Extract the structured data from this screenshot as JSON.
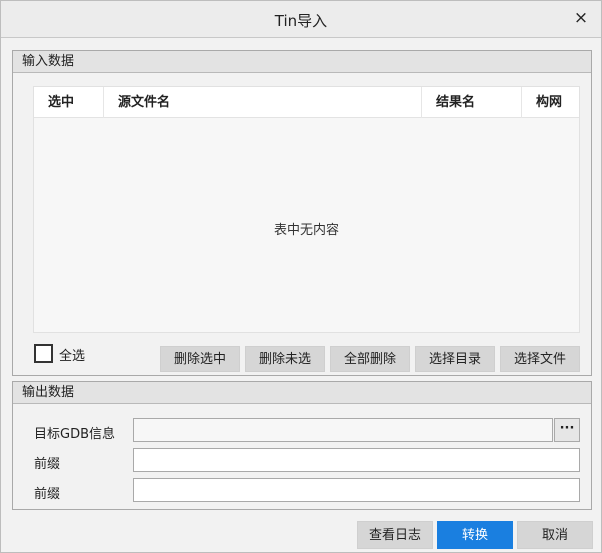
{
  "window": {
    "title": "Tin导入",
    "close_icon": "×"
  },
  "input_section": {
    "title": "输入数据",
    "columns": [
      "选中",
      "源文件名",
      "结果名",
      "构网"
    ],
    "empty_text": "表中无内容",
    "select_all_label": "全选",
    "buttons": [
      "删除选中",
      "删除未选",
      "全部删除",
      "选择目录",
      "选择文件"
    ]
  },
  "output_section": {
    "title": "输出数据",
    "target_gdb_label": "目标GDB信息",
    "target_gdb_value": "",
    "browse_label": "···",
    "prefix_label_1": "前缀",
    "prefix_value_1": "",
    "prefix_label_2": "前缀",
    "prefix_value_2": ""
  },
  "footer": {
    "view_log": "查看日志",
    "convert": "转换",
    "cancel": "取消"
  },
  "colors": {
    "primary": "#1a7fe0"
  }
}
